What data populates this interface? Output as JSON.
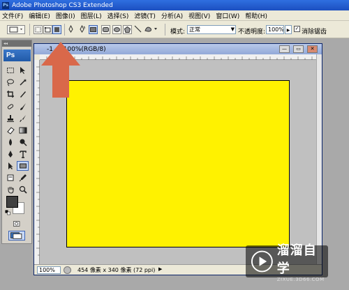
{
  "app": {
    "title": "Adobe Photoshop CS3 Extended",
    "logo": "Ps"
  },
  "menu": [
    "文件(F)",
    "编辑(E)",
    "图像(I)",
    "图层(L)",
    "选择(S)",
    "滤镜(T)",
    "分析(A)",
    "视图(V)",
    "窗口(W)",
    "帮助(H)"
  ],
  "options": {
    "style_label": "模式:",
    "style_value": "正常",
    "opacity_label": "不透明度:",
    "opacity_value": "100%",
    "antialias_label": "消除锯齿",
    "antialias_checked": true
  },
  "document": {
    "title": "-1 @ 100%(RGB/8)",
    "canvas_color": "#fff200"
  },
  "status": {
    "zoom": "100%",
    "info": "454 像素 x 340 像素 (72 ppi)"
  },
  "watermark": {
    "name": "溜溜自学",
    "url": "ZIXUE.3D66.COM"
  },
  "colors": {
    "arrow": "#d9684a",
    "title_blue": "#2f6fe0",
    "canvas": "#fff200"
  }
}
